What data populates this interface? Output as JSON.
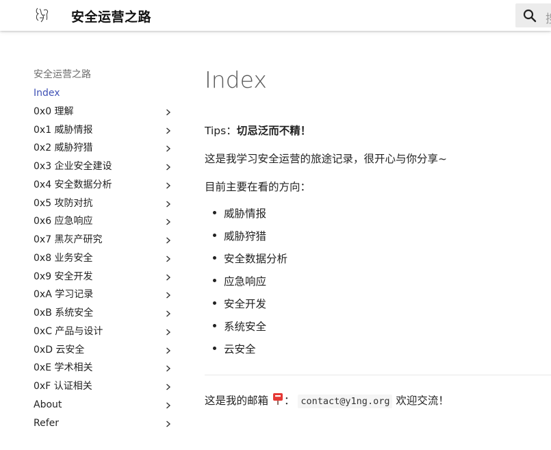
{
  "header": {
    "title": "安全运营之路",
    "search_placeholder": "搜"
  },
  "sidebar": {
    "title": "安全运营之路",
    "items": [
      {
        "label": "Index",
        "active": true,
        "expandable": false
      },
      {
        "label": "0x0 理解",
        "expandable": true
      },
      {
        "label": "0x1 威胁情报",
        "expandable": true
      },
      {
        "label": "0x2 威胁狩猎",
        "expandable": true
      },
      {
        "label": "0x3 企业安全建设",
        "expandable": true
      },
      {
        "label": "0x4 安全数据分析",
        "expandable": true
      },
      {
        "label": "0x5 攻防对抗",
        "expandable": true
      },
      {
        "label": "0x6 应急响应",
        "expandable": true
      },
      {
        "label": "0x7 黑灰产研究",
        "expandable": true
      },
      {
        "label": "0x8 业务安全",
        "expandable": true
      },
      {
        "label": "0x9 安全开发",
        "expandable": true
      },
      {
        "label": "0xA 学习记录",
        "expandable": true
      },
      {
        "label": "0xB 系统安全",
        "expandable": true
      },
      {
        "label": "0xC 产品与设计",
        "expandable": true
      },
      {
        "label": "0xD 云安全",
        "expandable": true
      },
      {
        "label": "0xE 学术相关",
        "expandable": true
      },
      {
        "label": "0xF 认证相关",
        "expandable": true
      },
      {
        "label": "About",
        "expandable": true
      },
      {
        "label": "Refer",
        "expandable": true
      }
    ]
  },
  "main": {
    "title": "Index",
    "tips_label": "Tips：",
    "tips_bold": "切忌泛而不精！",
    "intro": "这是我学习安全运营的旅途记录，很开心与你分享~",
    "direction_heading": "目前主要在看的方向：",
    "directions": [
      "威胁情报",
      "威胁狩猎",
      "安全数据分析",
      "应急响应",
      "安全开发",
      "系统安全",
      "云安全"
    ],
    "mail_prefix": "这是我的邮箱",
    "mail_colon": "：",
    "email": "contact@y1ng.org",
    "mail_suffix": " 欢迎交流！"
  },
  "colors": {
    "accent": "#3f51b5",
    "text": "#222222",
    "muted": "#6b6b6b",
    "search_bg": "#ececec"
  },
  "icons": {
    "logo": "logo-icon",
    "search": "search-icon",
    "chevron": "chevron-right-icon",
    "mailbox": "mailbox-icon"
  }
}
